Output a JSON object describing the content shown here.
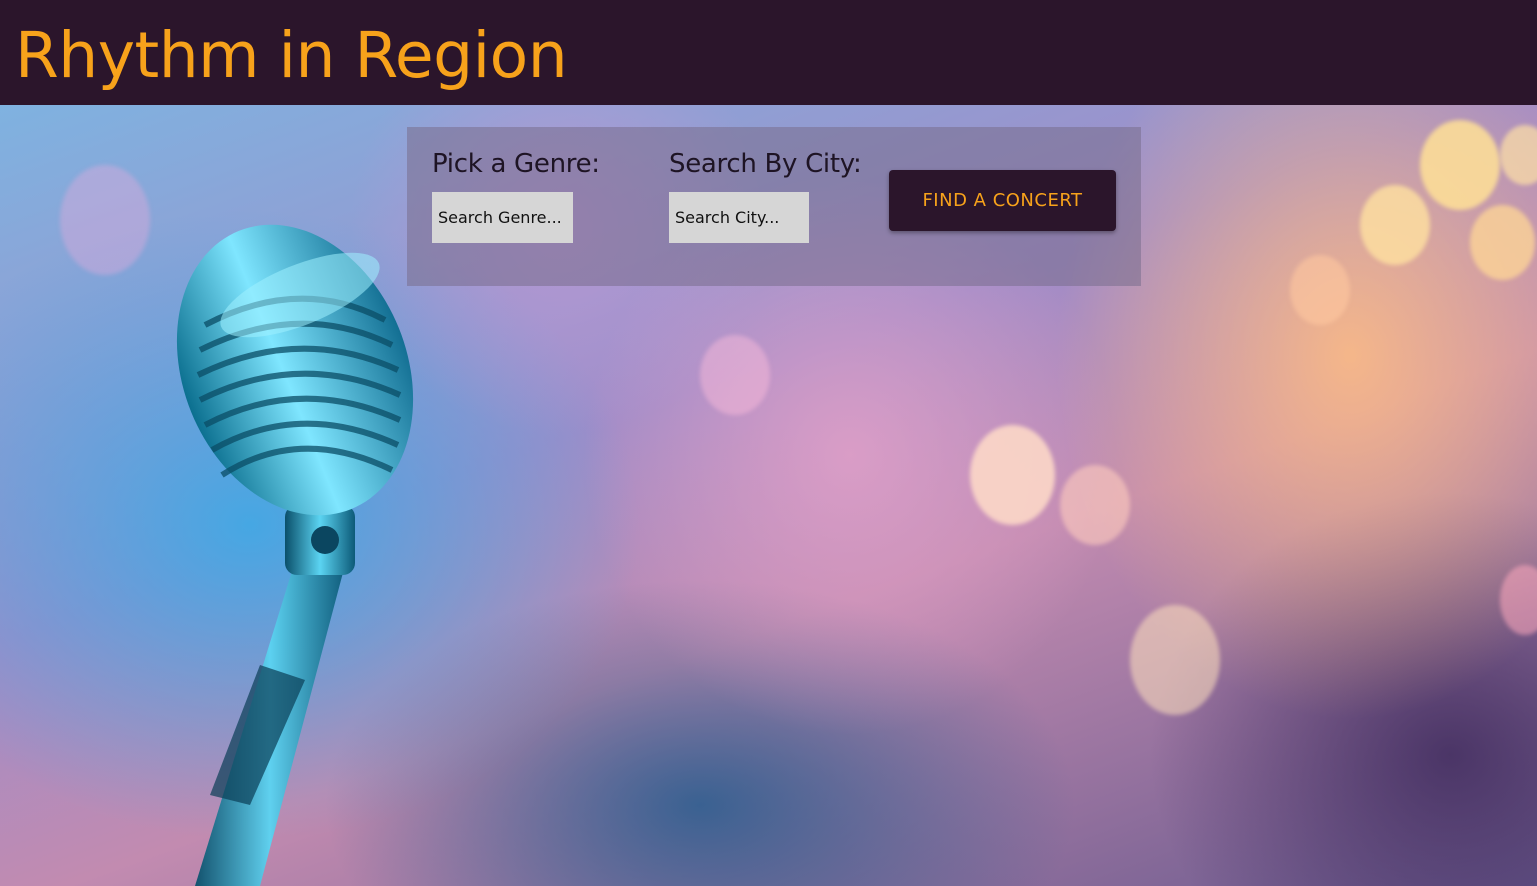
{
  "header": {
    "title": "Rhythm in Region"
  },
  "search": {
    "genre_label": "Pick a Genre:",
    "genre_placeholder": "Search Genre...",
    "city_label": "Search By City:",
    "city_placeholder": "Search City...",
    "button_label": "FIND A CONCERT"
  },
  "colors": {
    "header_bg": "#2b152b",
    "accent": "#f7a21b",
    "input_bg": "#d6d6d6"
  },
  "hero": {
    "icon": "microphone-icon"
  }
}
